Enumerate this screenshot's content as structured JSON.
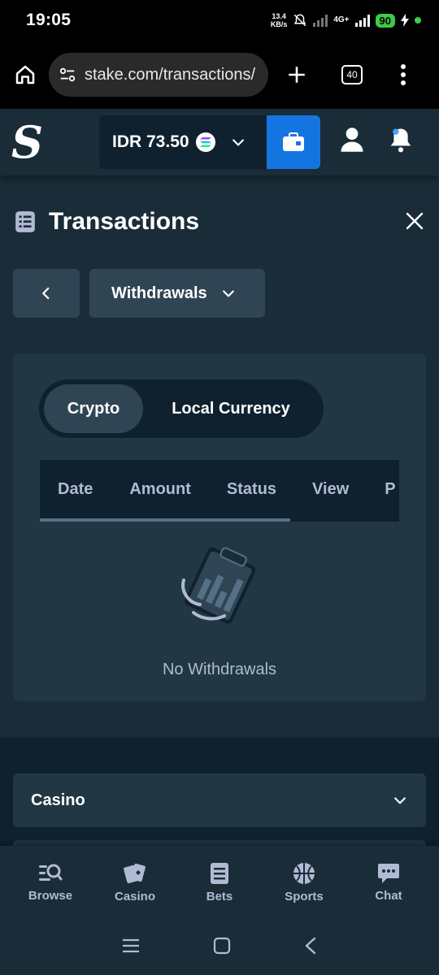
{
  "status_bar": {
    "time": "19:05",
    "net_speed_value": "13.4",
    "net_speed_unit": "KB/s",
    "network": "4G+",
    "battery": "90"
  },
  "browser": {
    "url": "stake.com/transactions/",
    "tab_count": "40"
  },
  "header": {
    "logo": "S",
    "balance": "IDR 73.50",
    "currency_icon": "solana-coin-icon"
  },
  "page": {
    "title": "Transactions",
    "filter_selected": "Withdrawals"
  },
  "toggle": {
    "options": [
      "Crypto",
      "Local Currency"
    ],
    "active": "Crypto"
  },
  "table": {
    "columns": [
      "Date",
      "Amount",
      "Status",
      "View",
      "P"
    ]
  },
  "empty": {
    "message": "No Withdrawals"
  },
  "footer": {
    "section": "Casino"
  },
  "bottom_nav": {
    "items": [
      {
        "label": "Browse",
        "icon": "browse-search-icon"
      },
      {
        "label": "Casino",
        "icon": "cards-icon"
      },
      {
        "label": "Bets",
        "icon": "betslip-icon"
      },
      {
        "label": "Sports",
        "icon": "basketball-icon"
      },
      {
        "label": "Chat",
        "icon": "chat-icon"
      }
    ]
  },
  "colors": {
    "bg": "#1a2c38",
    "panel": "#213743",
    "dark": "#0f212e",
    "button": "#2f4553",
    "accent": "#1475e1",
    "muted_text": "#b1bad3"
  }
}
